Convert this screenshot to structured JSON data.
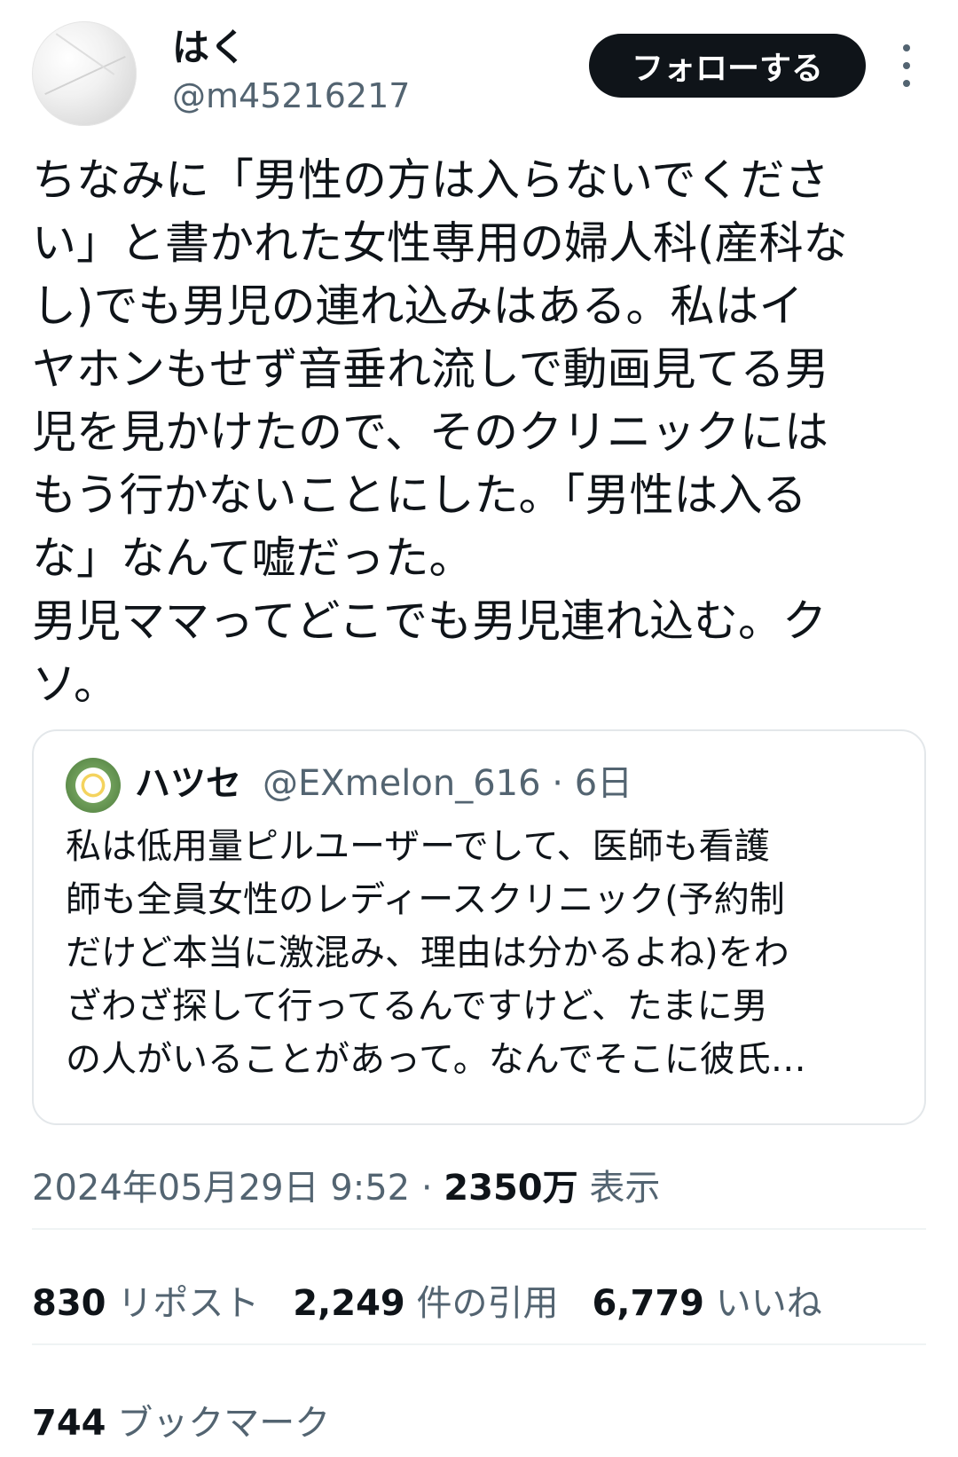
{
  "author": {
    "name": "はく",
    "handle": "@m45216217",
    "follow_label": "フォローする"
  },
  "tweet": {
    "text": "ちなみに「男性の方は入らないでくださ\nい」と書かれた女性専用の婦人科(産科な\nし)でも男児の連れ込みはある。私はイ\nヤホンもせず音垂れ流しで動画見てる男\n児を見かけたので、そのクリニックには\nもう行かないことにした。「男性は入る\nな」なんて嘘だった。\n男児ママってどこでも男児連れ込む。ク\nソ。"
  },
  "quote": {
    "name": "ハツセ",
    "handle": "@EXmelon_616",
    "separator": " · ",
    "time": "6日",
    "text": "私は低用量ピルユーザーでして、医師も看護\n師も全員女性のレディースクリニック(予約制\nだけど本当に激混み、理由は分かるよね)をわ\nざわざ探して行ってるんですけど、たまに男\nの人がいることがあって。なんでそこに彼氏…"
  },
  "meta": {
    "datetime": "2024年05月29日 9:52",
    "separator": " · ",
    "views_count": "2350万",
    "views_label": " 表示"
  },
  "stats": {
    "reposts_count": "830",
    "reposts_label": " リポスト",
    "quotes_count": "2,249",
    "quotes_label": " 件の引用",
    "likes_count": "6,779",
    "likes_label": " いいね"
  },
  "bookmarks": {
    "count": "744",
    "label": " ブックマーク"
  },
  "colors": {
    "text": "#0f1419",
    "secondary": "#536471",
    "border": "#eff3f4",
    "button_bg": "#0f1419"
  }
}
